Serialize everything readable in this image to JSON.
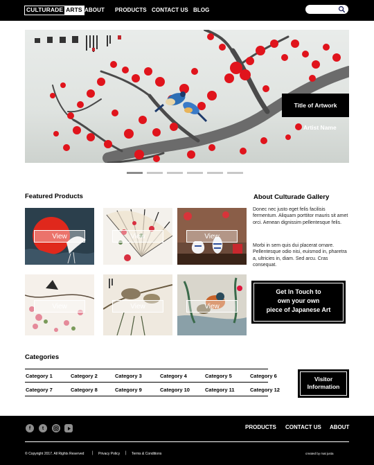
{
  "header": {
    "logo_part1": "CULTURADE",
    "logo_part2": "ARTS",
    "nav": [
      "ABOUT",
      "PRODUCTS",
      "CONTACT US",
      "BLOG"
    ],
    "search_placeholder": ""
  },
  "hero": {
    "title": "Title of Artwork",
    "artist": "Artist Name",
    "slides": 6,
    "active_slide": 1
  },
  "featured": {
    "title": "Featured Products",
    "view_label": "View"
  },
  "about": {
    "title": "About Culturade Gallery",
    "p1": "Donec nec justo eget felis facilisis fermentum. Aliquam porttitor mauris sit amet orci. Aenean dignissim pellentesque felis.",
    "p2": "Morbi in sem quis dui placerat ornare. Pellentesque odio nisi, euismod in, pharetra a, ultricies in, diam. Sed arcu. Cras consequat.",
    "cta_line1": "Get In Touch to",
    "cta_line2": "own your own",
    "cta_line3": "piece of Japanese Art"
  },
  "categories": {
    "title": "Categories",
    "items": [
      "Category 1",
      "Category 2",
      "Category 3",
      "Category 4",
      "Category 5",
      "Category 6",
      "Category 7",
      "Category 8",
      "Category 9",
      "Category 10",
      "Category 11",
      "Category 12"
    ],
    "visitor_line1": "Visitor",
    "visitor_line2": "Information"
  },
  "footer": {
    "links": [
      "PRODUCTS",
      "CONTACT US",
      "ABOUT"
    ],
    "copyright": "© Copyright 2017.  All Rights Reserved",
    "privacy": "Privacy Policy",
    "terms": "Terms & Conditions",
    "credit": "created by mat justa",
    "social_icons": [
      "facebook-icon",
      "twitter-icon",
      "instagram-icon",
      "youtube-icon"
    ]
  },
  "colors": {
    "header_bg": "#000000",
    "footer_bg": "#000000",
    "accent_red": "#e0141c"
  }
}
